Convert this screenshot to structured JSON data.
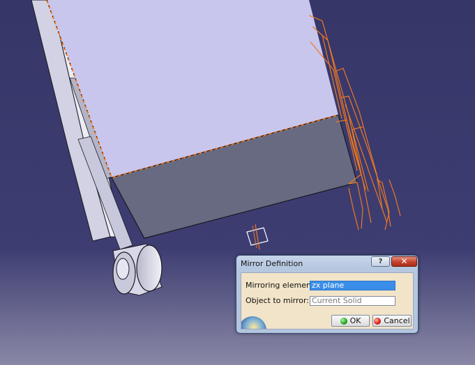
{
  "viewport": {
    "name": "3D model view",
    "background_top": "#363668",
    "background_bottom": "#8a88a6",
    "highlight_color": "#f07820"
  },
  "dialog": {
    "title": "Mirror Definition",
    "help_label": "?",
    "close_label": "✕",
    "mirroring_element_label": "Mirroring element:",
    "mirroring_element_value": "zx plane",
    "object_to_mirror_label": "Object to mirror:",
    "object_to_mirror_value": "Current Solid",
    "ok_label": "OK",
    "cancel_label": "Cancel"
  }
}
